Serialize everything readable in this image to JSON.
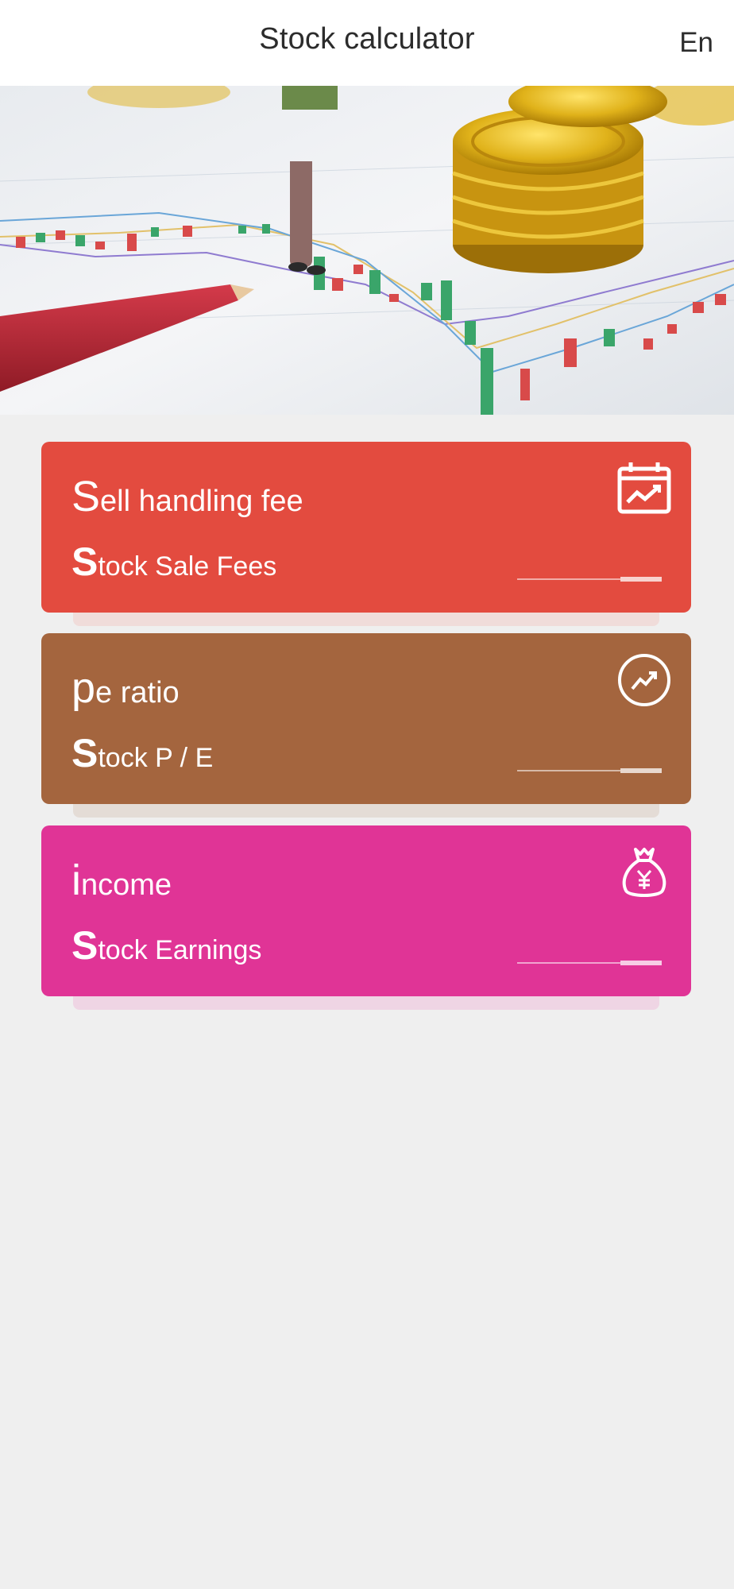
{
  "header": {
    "title": "Stock calculator",
    "language": "En"
  },
  "banner": {
    "icon": "stock-chart-coins-photo"
  },
  "cards": [
    {
      "title_initial": "S",
      "title_rest": "ell handling fee",
      "sub_initial": "S",
      "sub_rest": "tock Sale Fees",
      "color": "#e34b3f",
      "icon": "calendar-chart-icon"
    },
    {
      "title_initial": "p",
      "title_rest": "e ratio",
      "sub_initial": "S",
      "sub_rest": "tock P / E",
      "color": "#a4653e",
      "icon": "trend-up-circle-icon"
    },
    {
      "title_initial": "i",
      "title_rest": "ncome",
      "sub_initial": "S",
      "sub_rest": "tock Earnings",
      "color": "#e03496",
      "icon": "money-bag-yen-icon"
    }
  ]
}
